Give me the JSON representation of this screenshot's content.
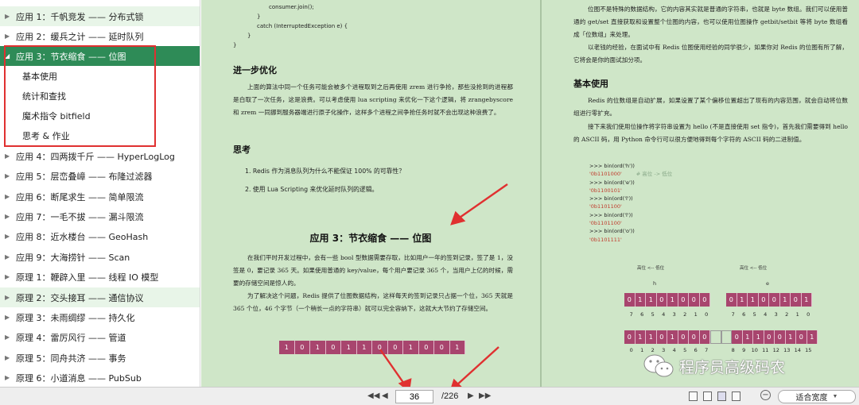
{
  "toc": {
    "items": [
      {
        "label": "应用 1：千帆竞发 —— 分布式锁",
        "state": "light",
        "expanded": false
      },
      {
        "label": "应用 2：缓兵之计 —— 延时队列",
        "state": "normal",
        "expanded": false
      },
      {
        "label": "应用 3：节衣缩食 —— 位图",
        "state": "active",
        "expanded": true
      },
      {
        "label": "应用 4：四两拨千斤 —— HyperLogLog",
        "state": "normal",
        "expanded": false
      },
      {
        "label": "应用 5：层峦叠嶂 —— 布隆过滤器",
        "state": "normal",
        "expanded": false
      },
      {
        "label": "应用 6：断尾求生 —— 简单限流",
        "state": "normal",
        "expanded": false
      },
      {
        "label": "应用 7：一毛不拔 —— 漏斗限流",
        "state": "normal",
        "expanded": false
      },
      {
        "label": "应用 8：近水楼台 —— GeoHash",
        "state": "normal",
        "expanded": false
      },
      {
        "label": "应用 9：大海捞针 —— Scan",
        "state": "normal",
        "expanded": false
      },
      {
        "label": "原理 1：鞭辟入里 —— 线程 IO 模型",
        "state": "normal",
        "expanded": false
      },
      {
        "label": "原理 2：交头接耳 —— 通信协议",
        "state": "light",
        "expanded": false
      },
      {
        "label": "原理 3：未雨绸缪 —— 持久化",
        "state": "normal",
        "expanded": false
      },
      {
        "label": "原理 4：雷厉风行 —— 管道",
        "state": "normal",
        "expanded": false
      },
      {
        "label": "原理 5：同舟共济 —— 事务",
        "state": "normal",
        "expanded": false
      },
      {
        "label": "原理 6：小道消息 —— PubSub",
        "state": "normal",
        "expanded": false
      }
    ],
    "subitems": [
      "基本使用",
      "统计和查找",
      "魔术指令 bitfield",
      "思考 & 作业"
    ]
  },
  "left_page": {
    "code": [
      "consumer.join();",
      "}",
      "catch (InterruptedException e) {",
      "}",
      "}"
    ],
    "section1_title": "进一步优化",
    "section1_p": "上面的算法中同一个任务可能会被多个进程取到之后再使用 zrem 进行争抢，那些没抢到的进程都是白取了一次任务，这是浪费。可以考虑使用 lua scripting 来优化一下这个逻辑，将 zrangebyscore 和 zrem 一同挪到服务器端进行原子化操作，这样多个进程之间争抢任务时就不会出现这种浪费了。",
    "section2_title": "思考",
    "q1": "1.  Redis 作为消息队列为什么不能保证 100% 的可靠性？",
    "q2": "2.  使用 Lua Scripting 来优化延时队列的逻辑。",
    "chapter_title": "应用 3：节衣缩食 —— 位图",
    "p1": "在我们平时开发过程中，会有一些 bool 型数据需要存取，比如用户一年的签到记录，签了是 1，没签是 0，要记录 365 天。如果使用普通的 key/value，每个用户要记录 365 个，当用户上亿的时候，需要的存储空间是惊人的。",
    "p2": "为了解决这个问题，Redis 提供了位图数据结构，这样每天的签到记录只占据一个位，365 天就是 365 个位，46 个字节（一个稍长一点的字符串）就可以完全容纳下，这就大大节约了存储空间。",
    "bits": [
      "1",
      "0",
      "1",
      "0",
      "1",
      "1",
      "0",
      "0",
      "1",
      "0",
      "0",
      "1"
    ]
  },
  "right_page": {
    "p1": "位图不是特殊的数据结构，它的内容其实就是普通的字符串，也就是 byte 数组。我们可以使用普通的 get/set 直接获取和设置整个位图的内容，也可以使用位图操作 getbit/setbit 等将 byte 数组看成「位数组」来处理。",
    "p2": "以老钱的经验，在面试中有 Redis 位图使用经验的同学很少，如果你对 Redis 的位图有所了解，它将会是你的面试加分项。",
    "section_title": "基本使用",
    "p3": "Redis 的位数组是自动扩展，如果设置了某个偏移位置超出了现有的内容范围，就会自动将位数组进行零扩充。",
    "p4": "接下来我们使用位操作将字符串设置为 hello (不是直接使用 set 指令)，首先我们需要得到 hello 的 ASCII 码，用 Python 命令行可以很方便地得到每个字符的 ASCII 码的二进制值。",
    "py_lines": [
      {
        "t": ">>> bin(ord('h'))",
        "c": "normal"
      },
      {
        "t": "'0b1101000'",
        "c": "red",
        "comment": "# 高位 -> 低位"
      },
      {
        "t": ">>> bin(ord('e'))",
        "c": "normal"
      },
      {
        "t": "'0b1100101'",
        "c": "red"
      },
      {
        "t": ">>> bin(ord('l'))",
        "c": "normal"
      },
      {
        "t": "'0b1101100'",
        "c": "red"
      },
      {
        "t": ">>> bin(ord('l'))",
        "c": "normal"
      },
      {
        "t": "'0b1101100'",
        "c": "red"
      },
      {
        "t": ">>> bin(ord('o'))",
        "c": "normal"
      },
      {
        "t": "'0b1101111'",
        "c": "red"
      }
    ],
    "diagram": {
      "left_caption": "高位 <-- 低位",
      "right_caption": "高位 <-- 低位",
      "left_char": "h",
      "right_char": "e",
      "h_bits": [
        "0",
        "1",
        "1",
        "0",
        "1",
        "0",
        "0",
        "0"
      ],
      "e_bits": [
        "0",
        "1",
        "1",
        "0",
        "0",
        "1",
        "0",
        "1"
      ],
      "h_index": [
        "7",
        "6",
        "5",
        "4",
        "3",
        "2",
        "1",
        "0"
      ],
      "e_index": [
        "7",
        "6",
        "5",
        "4",
        "3",
        "2",
        "1",
        "0"
      ],
      "merged_bits": [
        "0",
        "1",
        "1",
        "0",
        "1",
        "0",
        "0",
        "0",
        "",
        "",
        "0",
        "1",
        "1",
        "0",
        "0",
        "1",
        "0",
        "1"
      ],
      "merged_index_left": [
        "0",
        "1",
        "2",
        "3",
        "4",
        "5",
        "6",
        "7"
      ],
      "merged_index_right": [
        "8",
        "9",
        "10",
        "11",
        "12",
        "13",
        "14",
        "15"
      ]
    }
  },
  "watermark": "程序员高级码农",
  "toolbar": {
    "current_page": "36",
    "total_pages": "/226",
    "zoom": "适合宽度"
  },
  "colors": {
    "page_bg": "#cfe6c8",
    "active_toc": "#2e8b57",
    "light_toc": "#e8f5e8",
    "bit_fill": "#a8456e",
    "annotation_red": "#e03030"
  }
}
